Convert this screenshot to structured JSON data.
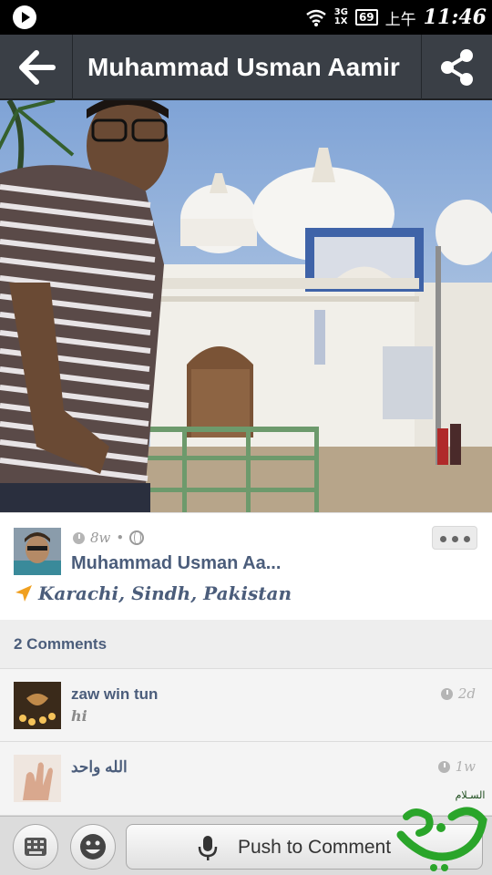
{
  "status_bar": {
    "network_top": "3G",
    "network_bottom": "1X",
    "battery": "69",
    "ampm": "上午",
    "time": "11:46"
  },
  "header": {
    "back_icon": "arrow-left-icon",
    "title": "Muhammad Usman Aamir",
    "share_icon": "share-icon"
  },
  "post": {
    "age": "8w",
    "separator": "•",
    "privacy_icon": "globe-icon",
    "author": "Muhammad Usman Aa...",
    "location_icon": "location-arrow-icon",
    "location": "Karachi, Sindh, Pakistan"
  },
  "comments": {
    "header": "2 Comments",
    "items": [
      {
        "author": "zaw win tun",
        "text": "hi",
        "time": "2d"
      },
      {
        "author": "الله واحد",
        "text": "",
        "time": "1w"
      }
    ]
  },
  "bottom_bar": {
    "keyboard_icon": "keyboard-icon",
    "emoji_icon": "emoji-icon",
    "mic_icon": "microphone-icon",
    "push_label": "Push to Comment"
  },
  "colors": {
    "action_bar": "#3a3f46",
    "link_text": "#4b5d7b",
    "location_arrow": "#f0a020",
    "watermark": "#2aa52a"
  }
}
